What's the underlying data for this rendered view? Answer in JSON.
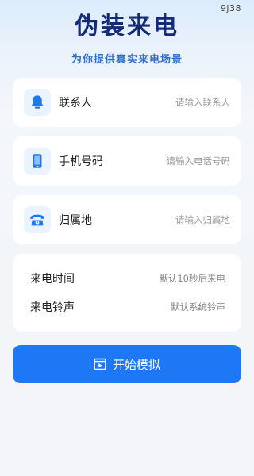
{
  "status_bar": {
    "time": "9j38"
  },
  "header": {
    "title": "伪装来电",
    "subtitle": "为你提供真实来电场景"
  },
  "form": {
    "contact": {
      "label": "联系人",
      "placeholder": "请输入联系人",
      "icon": "bell-icon"
    },
    "phone": {
      "label": "手机号码",
      "placeholder": "请输入电话号码",
      "icon": "phone-device-icon"
    },
    "location": {
      "label": "归属地",
      "placeholder": "请输入归属地",
      "icon": "telephone-icon"
    }
  },
  "settings": {
    "call_time": {
      "label": "来电时间",
      "value": "默认10秒后来电"
    },
    "ringtone": {
      "label": "来电铃声",
      "value": "默认系统铃声"
    }
  },
  "actions": {
    "start_label": "开始模拟",
    "icon": "play-icon"
  },
  "colors": {
    "accent": "#1e78f5",
    "title": "#142a7a",
    "subtitle": "#2e6fd6"
  }
}
